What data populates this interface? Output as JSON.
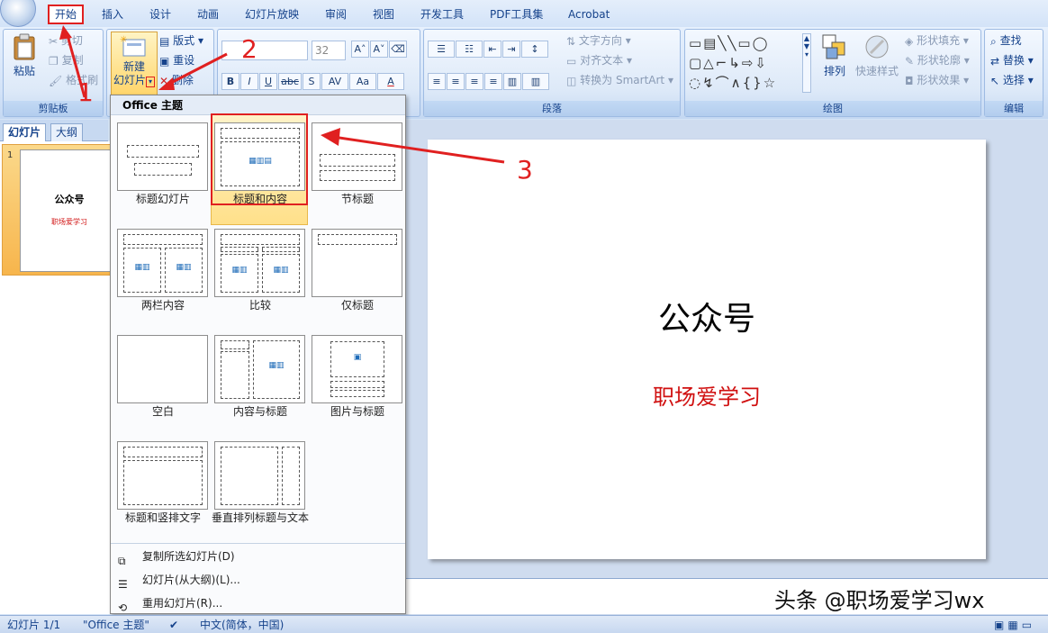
{
  "tabs": [
    "开始",
    "插入",
    "设计",
    "动画",
    "幻灯片放映",
    "审阅",
    "视图",
    "开发工具",
    "PDF工具集",
    "Acrobat"
  ],
  "clipboard": {
    "paste": "粘贴",
    "cut": "剪切",
    "copy": "复制",
    "format_painter": "格式刷",
    "group": "剪贴板"
  },
  "slides_group": {
    "new_slide_line1": "新建",
    "new_slide_line2": "幻灯片",
    "layout": "版式",
    "reset": "重设",
    "delete": "删除"
  },
  "font_group": {
    "font_size": "32",
    "bold": "B",
    "italic": "I",
    "underline": "U",
    "strike": "abc",
    "shadow": "S",
    "spacing": "AV",
    "case": "Aa",
    "color": "A"
  },
  "paragraph_group": {
    "text_direction": "文字方向",
    "align_text": "对齐文本",
    "smartart": "转换为 SmartArt",
    "group": "段落"
  },
  "drawing_group": {
    "arrange": "排列",
    "quick_styles": "快速样式",
    "shape_fill": "形状填充",
    "shape_outline": "形状轮廓",
    "shape_effects": "形状效果",
    "group": "绘图"
  },
  "editing_group": {
    "find": "查找",
    "replace": "替换",
    "select": "选择",
    "group": "编辑"
  },
  "panel_tabs": {
    "slides": "幻灯片",
    "outline": "大纲"
  },
  "thumbnail": {
    "number": "1",
    "title": "公众号",
    "subtitle": "职场爱学习"
  },
  "dropdown": {
    "header": "Office 主题",
    "layouts": [
      "标题幻灯片",
      "标题和内容",
      "节标题",
      "两栏内容",
      "比较",
      "仅标题",
      "空白",
      "内容与标题",
      "图片与标题",
      "标题和竖排文字",
      "垂直排列标题与文本"
    ],
    "menu": [
      "复制所选幻灯片(D)",
      "幻灯片(从大纲)(L)...",
      "重用幻灯片(R)..."
    ]
  },
  "slide": {
    "title": "公众号",
    "subtitle": "职场爱学习",
    "title_color": "#000000",
    "subtitle_color": "#d01010"
  },
  "annotations": [
    "1",
    "2",
    "3"
  ],
  "watermark": "头条 @职场爱学习wx",
  "status": {
    "slide": "幻灯片 1/1",
    "theme": "\"Office 主题\"",
    "language": "中文(简体，中国)"
  }
}
